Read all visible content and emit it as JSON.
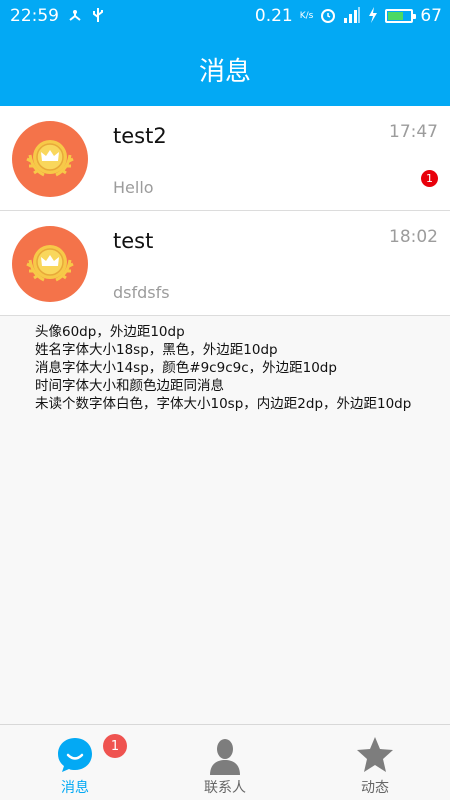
{
  "status_bar": {
    "time": "22:59",
    "speed": "0.21",
    "speed_unit": "K/s",
    "battery": "67"
  },
  "header": {
    "title": "消息"
  },
  "conversations": [
    {
      "name": "test2",
      "message": "Hello",
      "time": "17:47",
      "unread": "1"
    },
    {
      "name": "test",
      "message": "dsfdsfs",
      "time": "18:02"
    }
  ],
  "notes": [
    "头像60dp，外边距10dp",
    "姓名字体大小18sp，黑色，外边距10dp",
    "消息字体大小14sp，颜色#9c9c9c，外边距10dp",
    "时间字体大小和颜色边距同消息",
    "未读个数字体白色，字体大小10sp，内边距2dp，外边距10dp"
  ],
  "bottom_nav": {
    "tabs": [
      {
        "label": "消息",
        "icon": "chat-bubble-icon",
        "active": true,
        "badge": "1"
      },
      {
        "label": "联系人",
        "icon": "contact-person-icon",
        "active": false
      },
      {
        "label": "动态",
        "icon": "star-icon",
        "active": false
      }
    ]
  },
  "colors": {
    "primary": "#03a9f4",
    "avatar_bg": "#f4734a",
    "badge": "#e8000b",
    "secondary_text": "#9c9c9c"
  }
}
